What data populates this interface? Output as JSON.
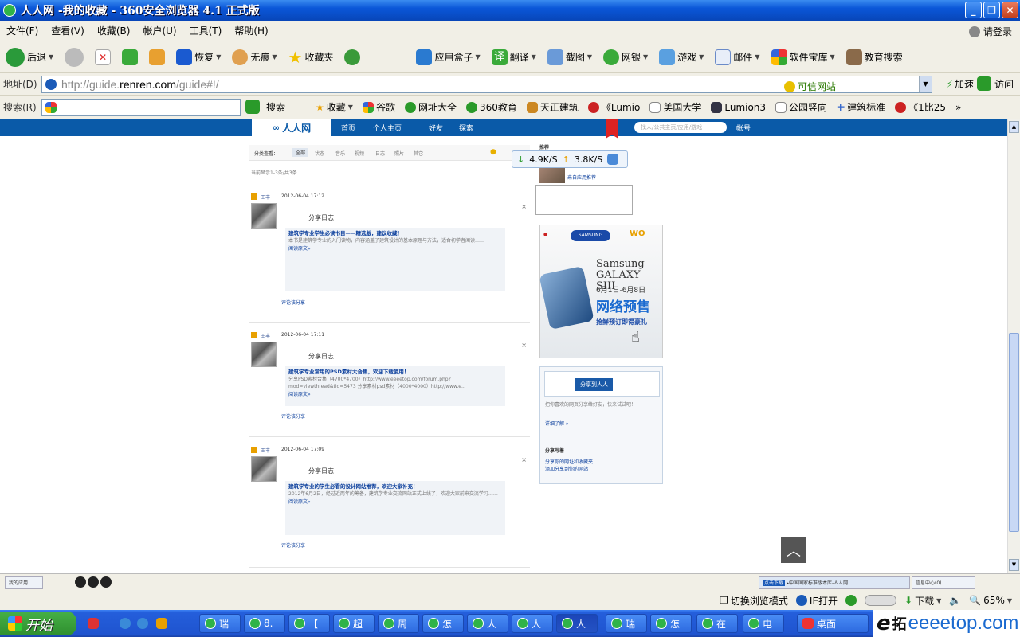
{
  "window": {
    "title": "人人网 -我的收藏 - 360安全浏览器 4.1 正式版"
  },
  "menu": [
    "文件(F)",
    "查看(V)",
    "收藏(B)",
    "帐户(U)",
    "工具(T)",
    "帮助(H)"
  ],
  "login": "请登录",
  "toolbar": {
    "back": "后退",
    "restore": "恢复",
    "notrace": "无痕",
    "favorites": "收藏夹",
    "appbox": "应用盒子",
    "translate": "翻译",
    "screenshot": "截图",
    "netbank": "网银",
    "games": "游戏",
    "mail": "邮件",
    "softlib": "软件宝库",
    "edusearch": "教育搜索"
  },
  "address": {
    "label": "地址(D)",
    "url_prefix": "http://guide.",
    "url_domain": "renren.com",
    "url_suffix": "/guide#!/",
    "trust": "可信网站",
    "speedup": "加速",
    "visit": "访问"
  },
  "search": {
    "label": "搜索(R)",
    "button": "搜索",
    "collect": "收藏"
  },
  "favs": [
    "谷歌",
    "网址大全",
    "360教育",
    "天正建筑",
    "《Lumio",
    "美国大学",
    "Lumion3",
    "公园竖向",
    "建筑标准",
    "《1比25"
  ],
  "renren": {
    "logo": "人人网",
    "nav": [
      "首页",
      "个人主页",
      "好友",
      "探索"
    ],
    "search_placeholder": "找人/公共主页/应用/游戏",
    "account": "帐号",
    "filter_label": "分类查看：",
    "filters": [
      "全部",
      "状态",
      "音乐",
      "视频",
      "日志",
      "照片",
      "其它"
    ],
    "count_text": "当前显示1-3条/共3条",
    "feeds": [
      {
        "name": "王丰",
        "time": "2012-06-04 17:12",
        "action": "分享日志",
        "title": "建筑学专业学生必读书目——精选版，建议收藏！",
        "body": "本书是建筑学专业的入门读物，内容涵盖了建筑设计的基本原理与方法，适合初学者阅读……",
        "more": "阅读原文»",
        "comment": "评论该分享"
      },
      {
        "name": "王丰",
        "time": "2012-06-04 17:11",
        "action": "分享日志",
        "title": "建筑学专业常用的PSD素材大合集，欢迎下载使用！",
        "body": "分享PSD素材合集（4700*4700）http://www.eeeetop.com/forum.php?mod=viewthread&tid=5473 分享素材psd素材（4000*4000）http://www.e...",
        "more": "阅读原文»",
        "comment": "评论该分享"
      },
      {
        "name": "王丰",
        "time": "2012-06-04 17:09",
        "action": "分享日志",
        "title": "建筑学专业的学生必看的设计网站推荐，欢迎大家补充！",
        "body": "2012年6月2日，经过近两年的筹备，建筑学专业交流网站正式上线了，欢迎大家前来交流学习……",
        "more": "阅读原文»",
        "comment": "评论该分享"
      }
    ],
    "side_title": "推荐",
    "side_desc": "来自应用推荐",
    "ad": {
      "brand": "SAMSUNG",
      "model": "Samsung GALAXY SIII",
      "date": "6月1日-6月8日",
      "presale": "网络预售",
      "gift": "抢鲜预订即得豪礼"
    },
    "share_box": {
      "button": "分享到人人",
      "desc": "把你喜欢的网页分享给好友，快来试试吧！",
      "more": "详细了解 »",
      "section": "分享写着",
      "links": [
        "分享你的网址和收藏夹",
        "添加分享到你的网站"
      ]
    }
  },
  "download": {
    "down": "4.9K/S",
    "up": "3.8K/S"
  },
  "tabs": [
    "我的应用",
    "点击下载",
    "▸中国国家标准版本库-人人网",
    "信息中心(0)"
  ],
  "status": {
    "switch_mode": "切换浏览模式",
    "ie_open": "IE打开",
    "download": "下载",
    "zoom": "65%"
  },
  "taskbar": {
    "start": "开始",
    "tasks": [
      "瑞",
      "8.",
      "【",
      "超",
      "周",
      "怎",
      "人",
      "人",
      "人",
      "瑞",
      "怎",
      "在",
      "电",
      "桌面"
    ]
  },
  "watermark": {
    "e": "e",
    "zh": "拓",
    "domain": "eeeetop.com"
  }
}
